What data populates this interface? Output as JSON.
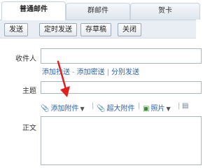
{
  "tabs": [
    {
      "label": "普通邮件",
      "active": true
    },
    {
      "label": "群邮件",
      "active": false
    },
    {
      "label": "贺卡",
      "active": false
    }
  ],
  "toolbar": {
    "send_label": "发送",
    "scheduled_send_label": "定时发送",
    "save_draft_label": "存草稿",
    "close_label": "关闭"
  },
  "form": {
    "recipient_label": "收件人",
    "recipient_value": "",
    "add_cc_label": "添加抄送",
    "add_bcc_label": "添加密送",
    "separate_send_label": "分别发送",
    "separator": "-",
    "separator2": "|",
    "subject_label": "主题",
    "subject_value": "",
    "body_label": "正文",
    "body_value": ""
  },
  "attachments": {
    "add_attachment_label": "添加附件",
    "large_attachment_label": "超大附件",
    "photo_label": "照片"
  },
  "colors": {
    "link": "#2a62b0",
    "toolbar_bg": "#e9eef4",
    "annotation_arrow": "#e02020"
  },
  "icons": {
    "attachment": "paperclip-icon",
    "large_attachment": "paperclip-large-icon",
    "photo": "photo-icon",
    "document": "document-icon"
  }
}
